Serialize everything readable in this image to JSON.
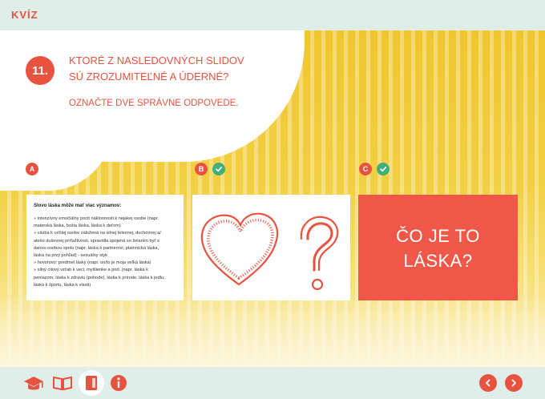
{
  "header": {
    "title": "KVÍZ"
  },
  "question": {
    "number": "11.",
    "line1": "KTORÉ Z NASLEDOVNÝCH SLIDOV",
    "line2": "SÚ ZROZUMITEĽNÉ A ÚDERNÉ?",
    "instruction": "OZNAČTE DVE SPRÁVNE ODPOVEDE."
  },
  "options": [
    {
      "label": "A",
      "checked": false
    },
    {
      "label": "B",
      "checked": true
    },
    {
      "label": "C",
      "checked": true
    }
  ],
  "card_a": {
    "heading": "Slovo láska môže mať viac významov:",
    "lines": [
      "» intenzívny emočiálny pocit náklonnosti k nejakej osobe (napr.",
      "materská láska, božia láska, láska k deťom)",
      "» väzba k určitej osobe založená na silnej telesnej, duchovnej a/",
      "alebo duševnej príťažlivosti, spravidla spojená so želaním byť s",
      "danou osobou spolu (napr. láska k partnerovi, platonická láska,",
      "láska na prvý pohľad) - sexuálny styk",
      "» hovorovo: predmet lásky (napr. on/to je moja veľká láska)",
      "» silný citový vzťah k veci, myšlienke a pod. (napr. láska k",
      "peniazom, láska k zdraviu (pohode), láska k prírode, láska k jedlu,",
      "láska k športu, láska k vlasti)"
    ]
  },
  "card_c": {
    "line1": "ČO JE TO",
    "line2": "LÁSKA?"
  },
  "colors": {
    "accent": "#e8533f",
    "check": "#3fb07a",
    "cardC": "#ef5848",
    "stripeYellow": "#f2cf42",
    "bar": "#dfeee8"
  },
  "footer": {
    "icons": [
      "graduation-cap-icon",
      "book-icon",
      "document-icon",
      "info-icon"
    ],
    "nav": [
      "prev-arrow-icon",
      "next-arrow-icon"
    ]
  }
}
